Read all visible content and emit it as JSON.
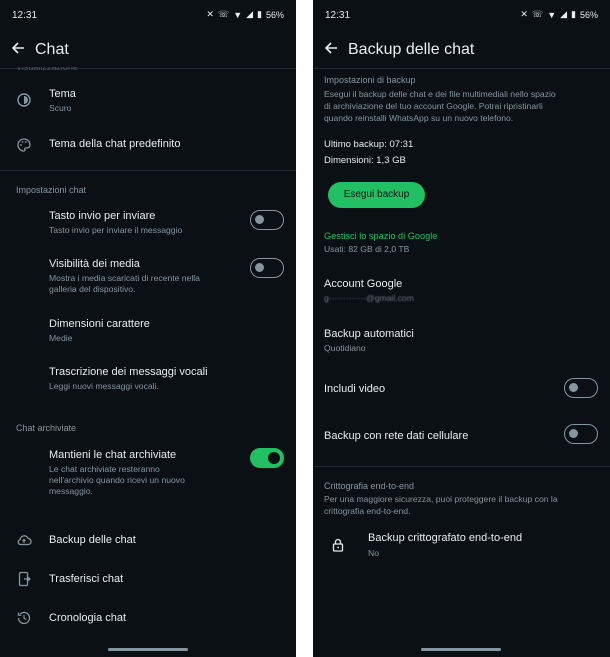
{
  "left": {
    "status": {
      "time": "12:31",
      "battery": "56%"
    },
    "title": "Chat",
    "clipped_header": "Visualizzazione",
    "items": {
      "tema": {
        "label": "Tema",
        "sub": "Scuro"
      },
      "tema_chat": {
        "label": "Tema della chat predefinito"
      }
    },
    "sec_chat": "Impostazioni chat",
    "tasto_invio": {
      "label": "Tasto invio per inviare",
      "sub": "Tasto invio per inviare il messaggio",
      "on": false
    },
    "visibilita": {
      "label": "Visibilità dei media",
      "sub1": "Mostra i media scaricati di recente nella",
      "sub2": "galleria del dispositivo.",
      "on": false
    },
    "dimensioni": {
      "label": "Dimensioni carattere",
      "sub": "Medie"
    },
    "trascrizione": {
      "label": "Trascrizione dei messaggi vocali",
      "sub": "Leggi nuovi messaggi vocali."
    },
    "sec_archived": "Chat archiviate",
    "mantieni": {
      "label": "Mantieni le chat archiviate",
      "sub1": "Le chat archiviate resteranno",
      "sub2": "nell'archivio quando ricevi un nuovo",
      "sub3": "messaggio.",
      "on": true
    },
    "backup": {
      "label": "Backup delle chat"
    },
    "trasferisci": {
      "label": "Trasferisci chat"
    },
    "cronologia": {
      "label": "Cronologia chat"
    }
  },
  "right": {
    "status": {
      "time": "12:31",
      "battery": "56%"
    },
    "title": "Backup delle chat",
    "sec_backup": "Impostazioni di backup",
    "desc1": "Esegui il backup delle chat e dei file multimediali nello spazio",
    "desc2": "di archiviazione del tuo account Google. Potrai ripristinarli",
    "desc3": "quando reinstalli WhatsApp su un nuovo telefono.",
    "ultimo": "Ultimo backup: 07:31",
    "dimensioni": "Dimensioni: 1,3 GB",
    "btn_backup": "Esegui backup",
    "gestisci": "Gestisci lo spazio di Google",
    "usati": "Usati: 82 GB di 2,0 TB",
    "account": {
      "label": "Account Google",
      "email": "g·············@gmail.com"
    },
    "automatici": {
      "label": "Backup automatici",
      "sub": "Quotidiano"
    },
    "video": {
      "label": "Includi video",
      "on": false
    },
    "rete": {
      "label": "Backup con rete dati cellulare",
      "on": false
    },
    "sec_e2e": "Crittografia end-to-end",
    "e2e_desc1": "Per una maggiore sicurezza, puoi proteggere il backup con la",
    "e2e_desc2": "crittografia end-to-end.",
    "e2e": {
      "label": "Backup crittografato end-to-end",
      "sub": "No"
    }
  }
}
